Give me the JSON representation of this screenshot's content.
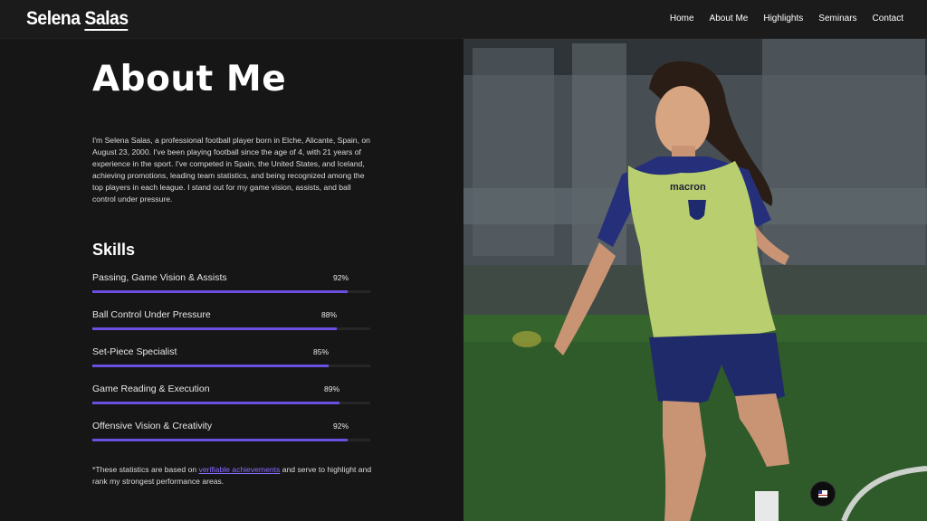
{
  "header": {
    "logo_first": "Selena ",
    "logo_last": "Salas",
    "nav": [
      "Home",
      "About Me",
      "Highlights",
      "Seminars",
      "Contact"
    ]
  },
  "about": {
    "title": "About Me",
    "bio": "I'm Selena Salas, a professional football player born in Elche, Alicante, Spain, on August 23, 2000. I've been playing football since the age of 4, with 21 years of experience in the sport. I've competed in Spain, the United States, and Iceland, achieving promotions, leading team statistics, and being recognized among the top players in each league. I stand out for my game vision, assists, and ball control under pressure."
  },
  "skills": {
    "heading": "Skills",
    "items": [
      {
        "label": "Passing, Game Vision & Assists",
        "percent_text": "92%",
        "value": 92
      },
      {
        "label": "Ball Control Under Pressure",
        "percent_text": "88%",
        "value": 88
      },
      {
        "label": "Set-Piece Specialist",
        "percent_text": "85%",
        "value": 85
      },
      {
        "label": "Game Reading & Execution",
        "percent_text": "89%",
        "value": 89
      },
      {
        "label": "Offensive Vision & Creativity",
        "percent_text": "92%",
        "value": 92
      }
    ]
  },
  "note": {
    "before": "*These statistics are based on ",
    "link": "verifiable achievements",
    "after": " and serve to highlight and rank my strongest performance areas."
  },
  "photo": {
    "bib_brand": "macron"
  },
  "colors": {
    "accent": "#6b4fe0",
    "link": "#8a6cff",
    "background": "#161616"
  }
}
